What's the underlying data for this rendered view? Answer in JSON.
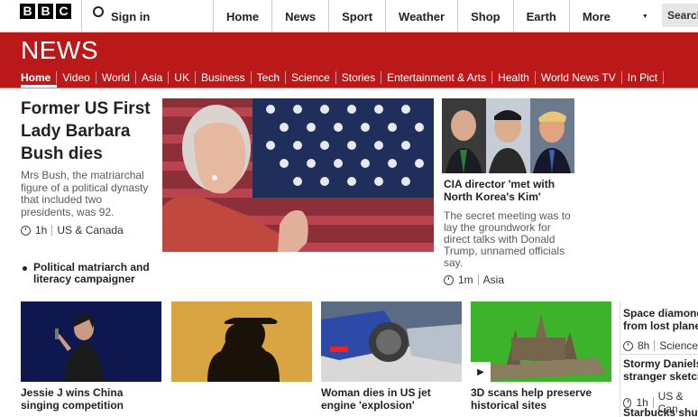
{
  "header": {
    "logo_letters": [
      "B",
      "B",
      "C"
    ],
    "signin_label": "Sign in",
    "nav": [
      "Home",
      "News",
      "Sport",
      "Weather",
      "Shop",
      "Earth"
    ],
    "more_label": "More",
    "search_label": "Search"
  },
  "news_bar": {
    "title": "NEWS",
    "sections": [
      "Home",
      "Video",
      "World",
      "Asia",
      "UK",
      "Business",
      "Tech",
      "Science",
      "Stories",
      "Entertainment & Arts",
      "Health",
      "World News TV",
      "In Pict"
    ],
    "active_section": "Home"
  },
  "lead": {
    "headline": "Former US First Lady Barbara Bush dies",
    "summary": "Mrs Bush, the matriarchal figure of a political dynasty that included two presidents, was 92.",
    "time": "1h",
    "category": "US & Canada",
    "related": "Political matriarch and literacy campaigner"
  },
  "secondary": {
    "headline": "CIA director 'met with North Korea's Kim'",
    "summary": "The secret meeting was to lay the groundwork for direct talks with Donald Trump, unnamed officials say.",
    "time": "1m",
    "category": "Asia"
  },
  "bottom_cards": [
    {
      "headline": "Jessie J wins China singing competition"
    },
    {
      "headline": ""
    },
    {
      "headline": "Woman dies in US jet engine 'explosion'"
    },
    {
      "headline": "3D scans help preserve historical sites"
    }
  ],
  "right_column": {
    "items": [
      {
        "headline_line1": "Space diamond",
        "headline_line2": "from lost plane",
        "time": "8h",
        "category": "Science"
      },
      {
        "headline_line1": "Stormy Daniels",
        "headline_line2": "stranger sketch",
        "time": "1h",
        "category": "US & Can"
      },
      {
        "headline_line1": "Starbucks shuts",
        "headline_line2": ""
      }
    ]
  },
  "colors": {
    "news_red": "#bb1919",
    "text": "#222222",
    "summary_text": "#5a5a5a"
  }
}
